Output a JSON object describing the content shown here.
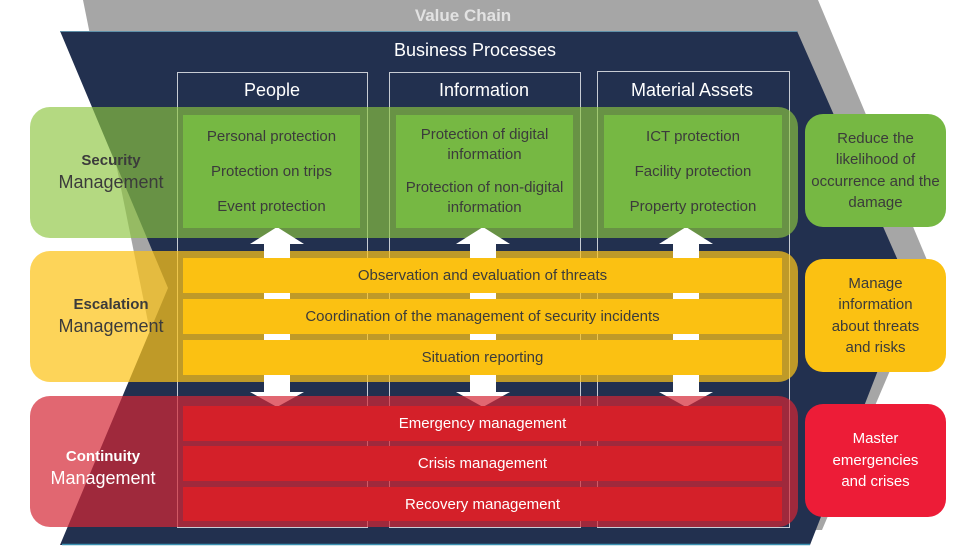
{
  "header": {
    "value_chain": "Value Chain",
    "business_processes": "Business Processes"
  },
  "columns": [
    {
      "label": "People"
    },
    {
      "label": "Information"
    },
    {
      "label": "Material Assets"
    }
  ],
  "security": {
    "title_bold": "Security",
    "title": "Management",
    "color": "#8dc63f",
    "boxes": [
      {
        "items": [
          "Personal protection",
          "Protection on trips",
          "Event protection"
        ]
      },
      {
        "items": [
          "Protection of digital information",
          "Protection of non-digital information"
        ]
      },
      {
        "items": [
          "ICT protection",
          "Facility protection",
          "Property protection"
        ]
      }
    ],
    "goal": "Reduce the likelihood of occurrence and the damage"
  },
  "escalation": {
    "title_bold": "Escalation",
    "title": "Management",
    "color": "#fbc112",
    "rows": [
      "Observation and evaluation of threats",
      "Coordination of the management of security incidents",
      "Situation reporting"
    ],
    "goal": "Manage information about threats and risks"
  },
  "continuity": {
    "title_bold": "Continuity",
    "title": "Management",
    "color": "#d42029",
    "rows": [
      "Emergency management",
      "Crisis management",
      "Recovery management"
    ],
    "goal": "Master emergencies and crises"
  },
  "icons": {
    "up_arrow": "arrow-up-icon",
    "down_arrow": "arrow-down-icon"
  }
}
